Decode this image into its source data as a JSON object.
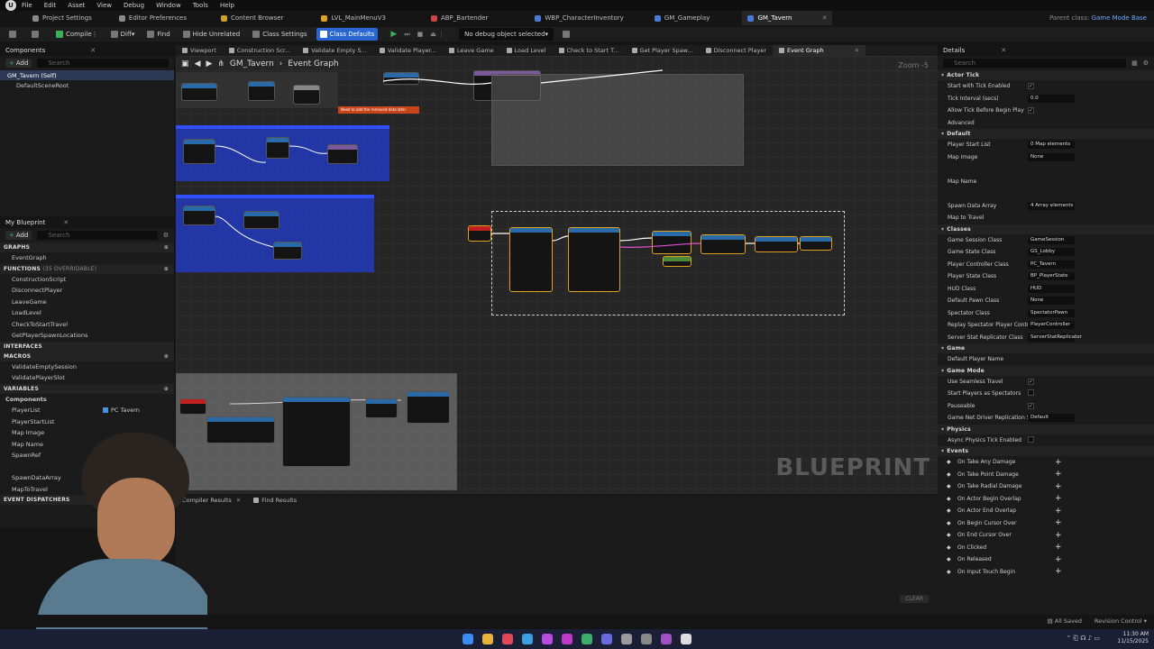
{
  "menu": {
    "items": [
      "File",
      "Edit",
      "Asset",
      "View",
      "Debug",
      "Window",
      "Tools",
      "Help"
    ]
  },
  "doctabs": [
    {
      "label": "Project Settings",
      "color": "#8a8a8a"
    },
    {
      "label": "Editor Preferences",
      "color": "#8a8a8a"
    },
    {
      "label": "Content Browser",
      "color": "#c9a227"
    },
    {
      "label": "LVL_MainMenuV3",
      "color": "#e0a020"
    },
    {
      "label": "ABP_Bartender",
      "color": "#cc4444"
    },
    {
      "label": "WBP_CharacterInventory",
      "color": "#4a7ad8"
    },
    {
      "label": "GM_Gameplay",
      "color": "#4a7ad8"
    },
    {
      "label": "GM_Tavern",
      "color": "#4a7ad8"
    }
  ],
  "parent_class": {
    "label": "Parent class:",
    "value": "Game Mode Base"
  },
  "toolbar": {
    "compile": "Compile",
    "diff": "Diff",
    "find": "Find",
    "hide_unrelated": "Hide Unrelated",
    "class_settings": "Class Settings",
    "class_defaults": "Class Defaults",
    "debug_object": "No debug object selected"
  },
  "components": {
    "title": "Components",
    "add": "Add",
    "search_placeholder": "Search",
    "items": [
      "GM_Tavern (Self)",
      "DefaultSceneRoot"
    ]
  },
  "my_blueprint": {
    "title": "My Blueprint",
    "add": "Add",
    "search_placeholder": "Search",
    "graphs_label": "GRAPHS",
    "graphs": [
      "EventGraph"
    ],
    "functions_label": "FUNCTIONS",
    "functions_overridable": "(35 OVERRIDABLE)",
    "functions": [
      "ConstructionScript",
      "DisconnectPlayer",
      "LeaveGame",
      "LoadLevel",
      "CheckToStartTravel",
      "GetPlayerSpawnLocations"
    ],
    "interfaces_label": "INTERFACES",
    "macros_label": "MACROS",
    "macros": [
      "ValidateEmptySession",
      "ValidatePlayerSlot"
    ],
    "variables_label": "VARIABLES",
    "variables_category": "Components",
    "variables": [
      "PlayerList",
      "PlayerStartList",
      "Map Image",
      "Map Name",
      "SpawnRef",
      "",
      "SpawnDataArray",
      "MapToTravel"
    ],
    "player_list_type": "PC Tavern",
    "dispatchers_label": "EVENT DISPATCHERS"
  },
  "graph_tabs": [
    "Viewport",
    "Construction Scr...",
    "Validate Empty S...",
    "Validate Player...",
    "Leave Game",
    "Load Level",
    "Check to Start T...",
    "Get Player Spaw...",
    "Disconnect Player",
    "Event Graph"
  ],
  "graph": {
    "breadcrumb_root": "GM_Tavern",
    "breadcrumb_current": "Event Graph",
    "zoom": "Zoom -5",
    "watermark": "BLUEPRINT",
    "comment_note": "Need to add the removed data later"
  },
  "bottom_tabs": [
    "Compiler Results",
    "Find Results"
  ],
  "details": {
    "title": "Details",
    "search_placeholder": "Search",
    "sections": [
      {
        "name": "Actor Tick",
        "rows": [
          {
            "label": "Start with Tick Enabled",
            "value": "✓"
          },
          {
            "label": "Tick Interval (secs)",
            "value": "0.0"
          },
          {
            "label": "Allow Tick Before Begin Play",
            "value": "✓"
          },
          {
            "label": "Advanced",
            "value": ""
          }
        ]
      },
      {
        "name": "Default",
        "rows": [
          {
            "label": "Player Start List",
            "value": "0 Map elements"
          },
          {
            "label": "Map Image",
            "value": "None"
          },
          {
            "label": "",
            "value": ""
          },
          {
            "label": "Map Name",
            "value": ""
          },
          {
            "label": "",
            "value": ""
          },
          {
            "label": "Spawn Data Array",
            "value": "4 Array elements"
          },
          {
            "label": "Map to Travel",
            "value": ""
          }
        ]
      },
      {
        "name": "Classes",
        "rows": [
          {
            "label": "Game Session Class",
            "value": "GameSession"
          },
          {
            "label": "Game State Class",
            "value": "GS_Lobby"
          },
          {
            "label": "Player Controller Class",
            "value": "PC_Tavern"
          },
          {
            "label": "Player State Class",
            "value": "BP_PlayerState"
          },
          {
            "label": "HUD Class",
            "value": "HUD"
          },
          {
            "label": "Default Pawn Class",
            "value": "None"
          },
          {
            "label": "Spectator Class",
            "value": "SpectatorPawn"
          },
          {
            "label": "Replay Spectator Player Contr...",
            "value": "PlayerController"
          },
          {
            "label": "Server Stat Replicator Class",
            "value": "ServerStatReplicator"
          }
        ]
      },
      {
        "name": "Game",
        "rows": [
          {
            "label": "Default Player Name",
            "value": ""
          }
        ]
      },
      {
        "name": "Game Mode",
        "rows": [
          {
            "label": "Use Seamless Travel",
            "value": "✓"
          },
          {
            "label": "Start Players as Spectators",
            "value": ""
          },
          {
            "label": "Pauseable",
            "value": "✓"
          },
          {
            "label": "Game Net Driver Replication S...",
            "value": "Default"
          }
        ]
      },
      {
        "name": "Physics",
        "rows": [
          {
            "label": "Async Physics Tick Enabled",
            "value": ""
          }
        ]
      },
      {
        "name": "Events",
        "rows": [
          {
            "label": "On Take Any Damage",
            "value": "+"
          },
          {
            "label": "On Take Point Damage",
            "value": "+"
          },
          {
            "label": "On Take Radial Damage",
            "value": "+"
          },
          {
            "label": "On Actor Begin Overlap",
            "value": "+"
          },
          {
            "label": "On Actor End Overlap",
            "value": "+"
          },
          {
            "label": "On Begin Cursor Over",
            "value": "+"
          },
          {
            "label": "On End Cursor Over",
            "value": "+"
          },
          {
            "label": "On Clicked",
            "value": "+"
          },
          {
            "label": "On Released",
            "value": "+"
          },
          {
            "label": "On Input Touch Begin",
            "value": "+"
          }
        ]
      }
    ]
  },
  "status": {
    "all_saved": "All Saved",
    "revision_control": "Revision Control",
    "clear": "CLEAR"
  },
  "clock": {
    "time": "11:30 AM",
    "date": "11/15/2025"
  }
}
